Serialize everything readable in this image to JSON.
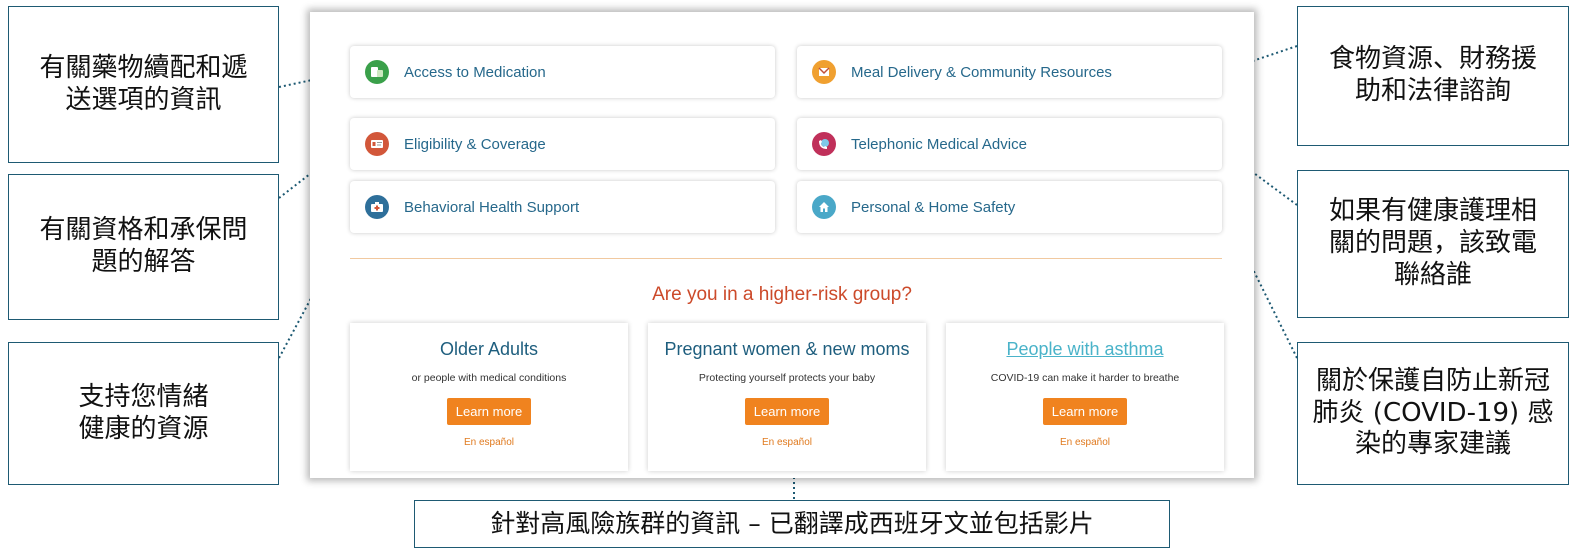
{
  "callouts": {
    "medication_info": "有關藥物續配和遞送選項的資訊",
    "eligibility_answers": "有關資格和承保問題的解答",
    "emotional_support": "支持您情緒健康的資源",
    "food_financial_legal": "食物資源、財務援助和法律諮詢",
    "health_questions": "如果有健康護理相關的問題，該致電聯絡誰",
    "covid_advice": "關於保護自防止新冠肺炎 (COVID-19) 感染的專家建議",
    "high_risk_info": "針對高風險族群的資訊 – 已翻譯成西班牙文並包括影片"
  },
  "tiles": [
    {
      "label": "Access to Medication",
      "icon": "medication-icon",
      "color": "#3aa04a"
    },
    {
      "label": "Meal Delivery & Community Resources",
      "icon": "meal-delivery-icon",
      "color": "#f0a030"
    },
    {
      "label": "Eligibility & Coverage",
      "icon": "id-card-icon",
      "color": "#d2573a"
    },
    {
      "label": "Telephonic Medical Advice",
      "icon": "phone-icon",
      "color": "#c0305a"
    },
    {
      "label": "Behavioral Health Support",
      "icon": "first-aid-kit-icon",
      "color": "#2e6f9a"
    },
    {
      "label": "Personal & Home Safety",
      "icon": "home-icon",
      "color": "#4aa8c8"
    }
  ],
  "risk": {
    "heading": "Are you in a higher-risk group?",
    "cards": [
      {
        "title": "Older Adults",
        "subtitle": "or people with medical conditions",
        "button": "Learn more",
        "spanish": "En español"
      },
      {
        "title": "Pregnant women & new moms",
        "subtitle": "Protecting yourself protects your baby",
        "button": "Learn more",
        "spanish": "En español"
      },
      {
        "title": "People with asthma",
        "subtitle": "COVID-19 can make it harder to breathe",
        "button": "Learn more",
        "spanish": "En español"
      }
    ]
  },
  "colors": {
    "accent_orange": "#f0831f",
    "heading_red": "#cc4a2a",
    "link_teal": "#26688b",
    "callout_border": "#1e5a73"
  }
}
